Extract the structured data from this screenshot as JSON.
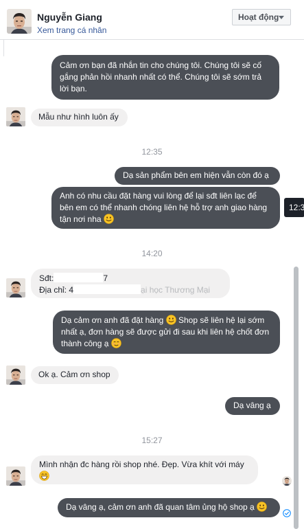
{
  "header": {
    "name": "Nguyễn Giang",
    "profile_link": "Xem trang cá nhân",
    "status_button": "Hoạt động"
  },
  "messages": {
    "m1": "Cảm ơn bạn đã nhắn tin cho chúng tôi. Chúng tôi sẽ cố gắng phản hồi nhanh nhất có thể. Chúng tôi sẽ sớm trả lời bạn.",
    "m2": "Mẫu như hình luôn ấy",
    "t1": "12:35",
    "m3": "Dạ sản phẩm bên em hiện vẫn còn đó ạ",
    "m4": "Anh có nhu cầu đặt hàng vui lòng để lại sđt liên lạc để bên em có thể nhanh chóng liên hệ hỗ trợ anh giao hàng tận nơi nha",
    "tooltip": "12:3",
    "t2": "14:20",
    "m5_line1_prefix": "Sđt:",
    "m5_line1_suffix": "7",
    "m5_line2_prefix": "Địa chỉ: 4",
    "m5_line2_suffix": "ại học Thương Mại",
    "m6": "Dạ cảm ơn anh đã đặt hàng",
    "m6b": "Shop sẽ liên hệ lại sớm nhất ạ, đơn hàng sẽ được gửi đi sau khi liên hệ chốt đơn thành công ạ",
    "m7": "Ok ạ. Cảm ơn shop",
    "m8": "Dạ vâng ạ",
    "t3": "15:27",
    "m9": "Mình nhận đc hàng rồi shop nhé. Đẹp. Vừa khít với máy",
    "m10": "Dạ vâng ạ, cảm ơn anh đã quan tâm ủng hộ shop ạ"
  },
  "colors": {
    "outgoing_bubble": "#4b4f56",
    "incoming_bubble": "#f1f0f0",
    "link": "#365899",
    "emoji": "#f7c325"
  },
  "icons": [
    "user-avatar-icon",
    "caret-down-icon",
    "emoji-smile-icon",
    "emoji-grin-icon",
    "seen-avatar-icon",
    "sent-check-icon"
  ]
}
